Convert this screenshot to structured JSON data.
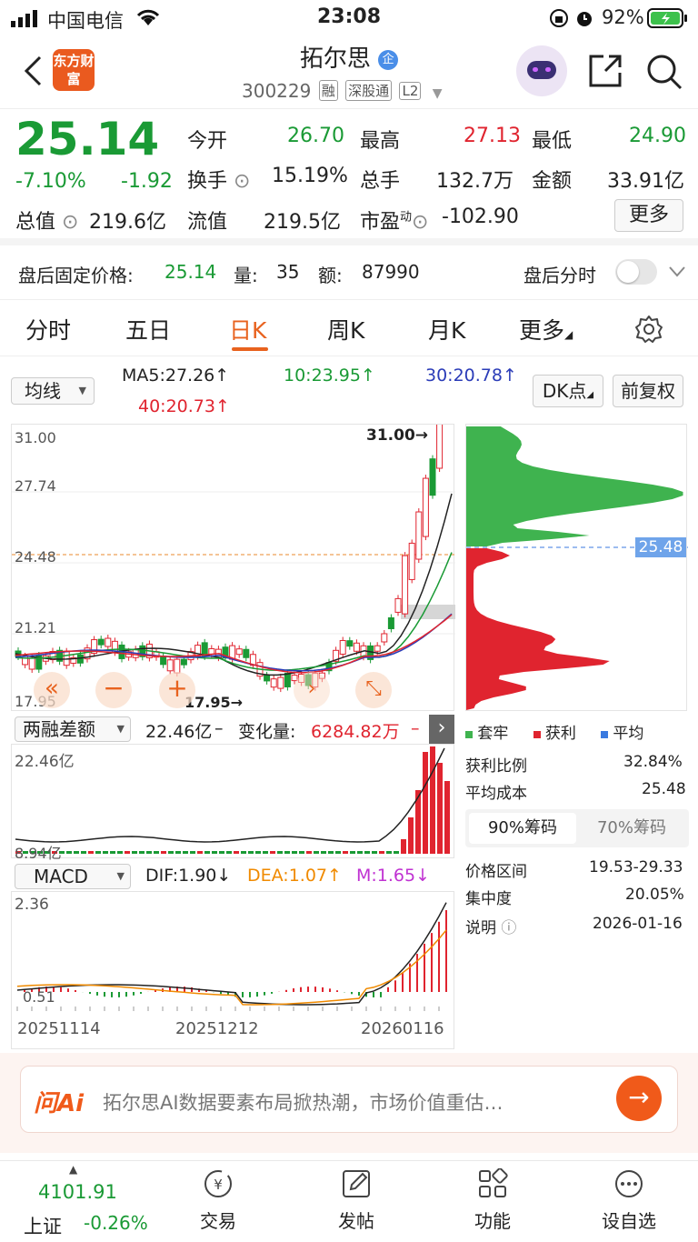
{
  "status_bar": {
    "carrier": "中国电信",
    "time": "23:08",
    "battery": "92%"
  },
  "header": {
    "logo": "东方财富",
    "stock_name": "拓尔思",
    "badge": "企",
    "code": "300229",
    "tags": [
      "融",
      "深股通",
      "L2"
    ]
  },
  "quote": {
    "price": "25.14",
    "change_pct": "-7.10%",
    "change": "-1.92",
    "fields": [
      {
        "label": "今开",
        "value": "26.70"
      },
      {
        "label": "最高",
        "value": "27.13"
      },
      {
        "label": "最低",
        "value": "24.90"
      },
      {
        "label": "换手",
        "value": "15.19%"
      },
      {
        "label": "总手",
        "value": "132.7万"
      },
      {
        "label": "金额",
        "value": "33.91亿"
      },
      {
        "label": "总值",
        "value": "219.6亿"
      },
      {
        "label": "流值",
        "value": "219.5亿"
      },
      {
        "label": "市盈",
        "sup": "动",
        "value": "-102.90"
      }
    ],
    "more_button": "更多"
  },
  "after_hours": {
    "label": "盘后固定价格:",
    "price": "25.14",
    "vol_label": "量:",
    "vol": "35",
    "amt_label": "额:",
    "amt": "87990",
    "switch_label": "盘后分时"
  },
  "tabs": [
    "分时",
    "五日",
    "日K",
    "周K",
    "月K",
    "更多"
  ],
  "ma_row": {
    "select": "均线",
    "ma5": "MA5:27.26↑",
    "ma10": "10:23.95↑",
    "ma30": "30:20.78↑",
    "ma40": "40:20.73↑",
    "dk_button": "DK点",
    "adjust_button": "前复权"
  },
  "kline": {
    "y_labels": [
      "31.00",
      "27.74",
      "24.48",
      "21.21",
      "17.95"
    ],
    "high_label": "31.00→",
    "low_label": "17.95→",
    "price_line_label": "25.48"
  },
  "margin": {
    "select": "两融差额",
    "value": "22.46亿",
    "change_label": "变化量:",
    "change_value": "6284.82万",
    "y_top": "22.46亿",
    "y_bottom": "8.94亿"
  },
  "macd": {
    "select": "MACD",
    "dif": "DIF:1.90↓",
    "dea": "DEA:1.07↑",
    "m": "M:1.65↓",
    "y_top": "2.36",
    "y_bottom": "0.51",
    "dates": [
      "20251114",
      "20251212",
      "20260116"
    ]
  },
  "chips": {
    "legend": [
      {
        "label": "套牢",
        "color": "#3fb34f"
      },
      {
        "label": "获利",
        "color": "#e0242f"
      },
      {
        "label": "平均",
        "color": "#3a7ae0"
      }
    ],
    "rows": [
      {
        "label": "获利比例",
        "value": "32.84%"
      },
      {
        "label": "平均成本",
        "value": "25.48"
      }
    ],
    "tabs": [
      "90%筹码",
      "70%筹码"
    ],
    "rows2": [
      {
        "label": "价格区间",
        "value": "19.53-29.33"
      },
      {
        "label": "集中度",
        "value": "20.05%"
      },
      {
        "label": "说明",
        "value": "2026-01-16"
      }
    ]
  },
  "ai_bar": {
    "brand": "问Ai",
    "text": "拓尔思AI数据要素布局掀热潮，市场价值重估…"
  },
  "bottom_bar": {
    "index_value": "4101.91",
    "index_name": "上证",
    "index_change": "-0.26%",
    "items": [
      "交易",
      "发帖",
      "功能",
      "设自选"
    ]
  },
  "colors": {
    "up": "#e0242f",
    "down": "#1a9a35",
    "accent": "#e8621e"
  }
}
